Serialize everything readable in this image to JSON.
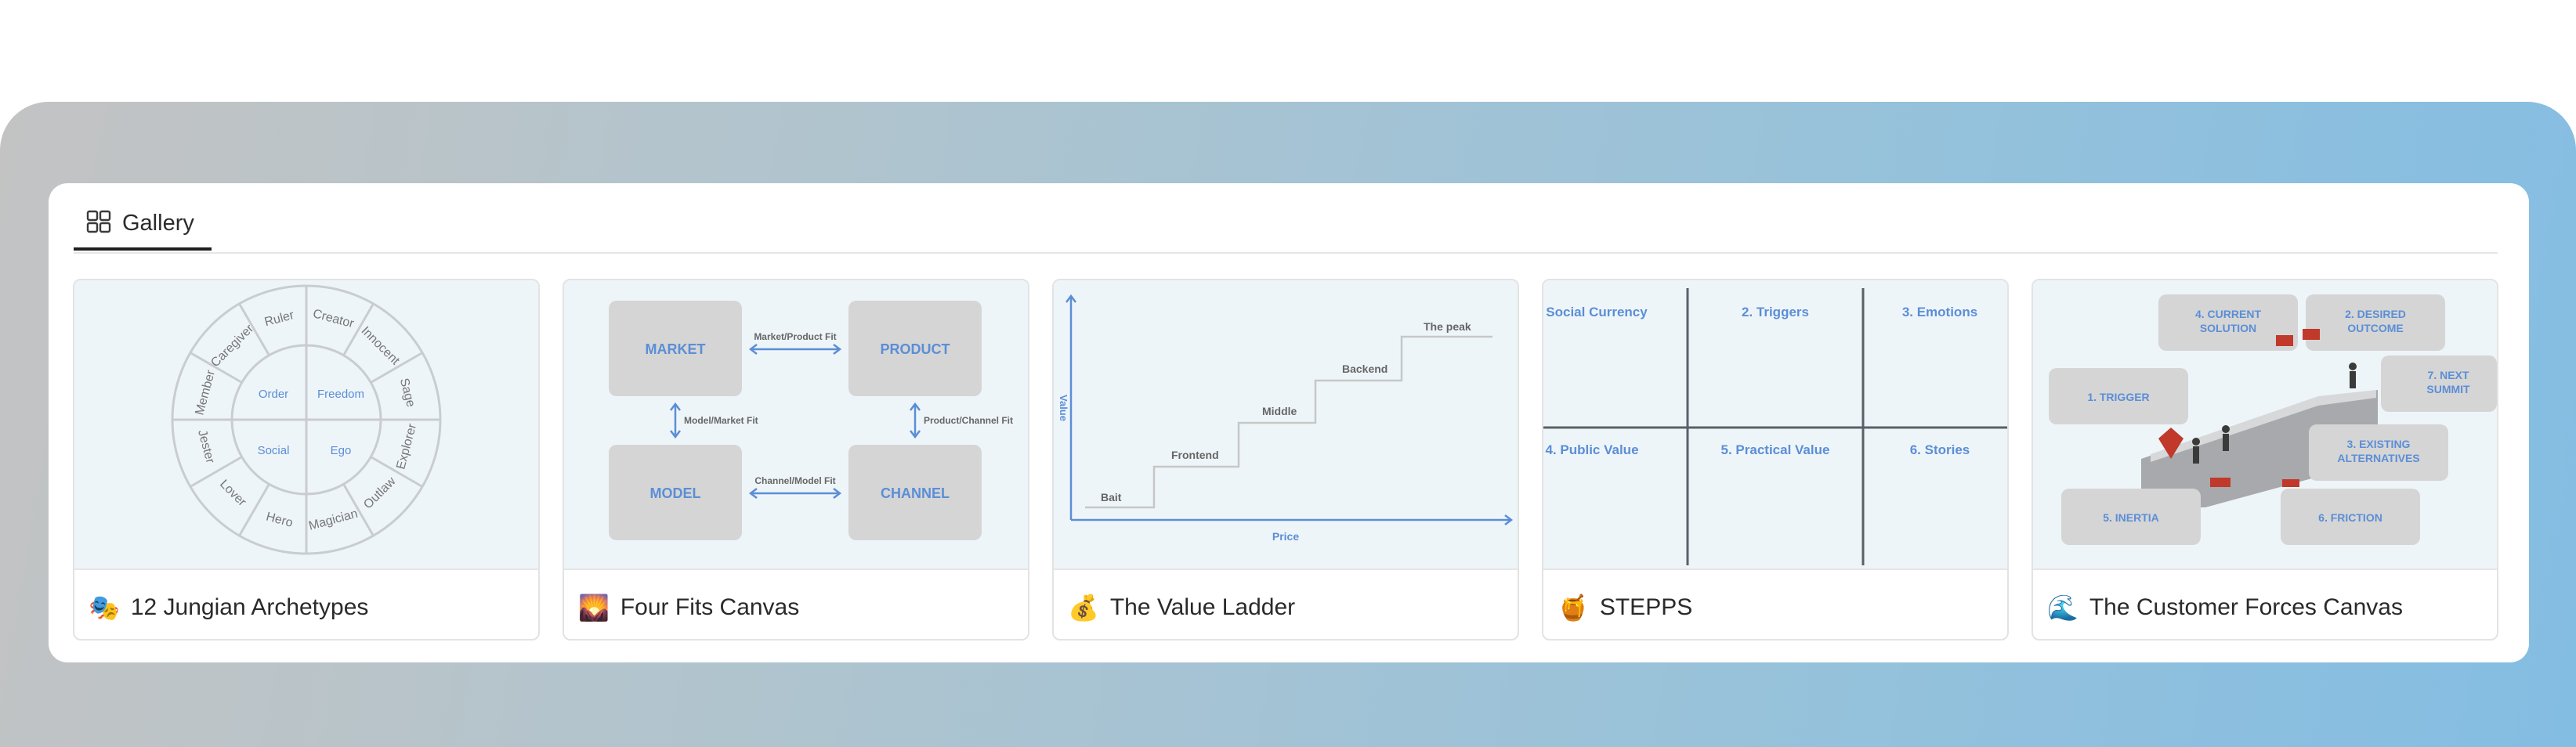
{
  "gallery": {
    "tab_label": "Gallery",
    "tab_icon": "grid-icon"
  },
  "cards": [
    {
      "title": "12 Jungian Archetypes",
      "emoji": "🎭",
      "outer_labels": [
        "Creator",
        "Innocent",
        "Sage",
        "Explorer",
        "Outlaw",
        "Magician",
        "Hero",
        "Lover",
        "Jester",
        "Member",
        "Caregiver",
        "Ruler"
      ],
      "inner_labels": [
        "Order",
        "Freedom",
        "Social",
        "Ego"
      ]
    },
    {
      "title": "Four Fits Canvas",
      "emoji": "🌄",
      "boxes": [
        "MARKET",
        "PRODUCT",
        "MODEL",
        "CHANNEL"
      ],
      "fits": [
        "Market/Product Fit",
        "Model/Market Fit",
        "Product/Channel Fit",
        "Channel/Model Fit"
      ]
    },
    {
      "title": "The Value Ladder",
      "emoji": "💰",
      "steps": [
        "Bait",
        "Frontend",
        "Middle",
        "Backend",
        "The peak"
      ],
      "xlabel": "Price",
      "ylabel": "Value"
    },
    {
      "title": "STEPPS",
      "emoji": "🍯",
      "cells": [
        "Social Currency",
        "2. Triggers",
        "3. Emotions",
        "4. Public Value",
        "5. Practical Value",
        "6. Stories"
      ]
    },
    {
      "title": "The Customer Forces Canvas",
      "emoji": "🌊",
      "boxes": [
        "4. CURRENT",
        "SOLUTION",
        "2. DESIRED",
        "OUTCOME",
        "7. NEXT",
        "SUMMIT",
        "1. TRIGGER",
        "3. EXISTING",
        "ALTERNATIVES",
        "5. INERTIA",
        "6. FRICTION"
      ]
    }
  ],
  "colors": {
    "accent_blue": "#5b8ed6",
    "box_gray": "#d5d5d5",
    "thumb_bg": "#eef5f9"
  }
}
